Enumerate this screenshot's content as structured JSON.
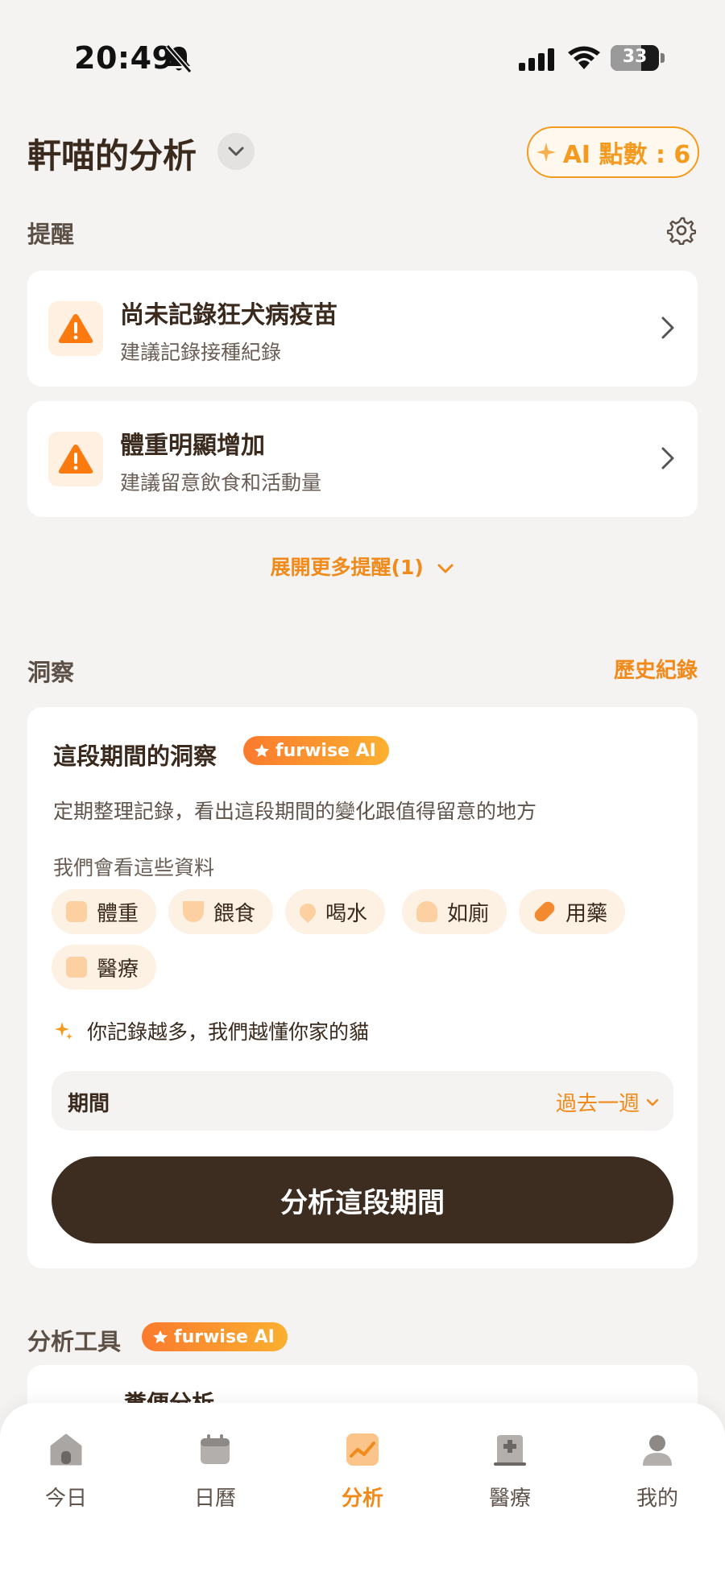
{
  "status_bar": {
    "time": "20:49",
    "battery": "33"
  },
  "header": {
    "title": "軒喵的分析",
    "ai_points_label": "AI 點數 : 6"
  },
  "reminders": {
    "heading": "提醒",
    "items": [
      {
        "title": "尚未記錄狂犬病疫苗",
        "subtitle": "建議記錄接種紀錄"
      },
      {
        "title": "體重明顯增加",
        "subtitle": "建議留意飲食和活動量"
      }
    ],
    "expand_label": "展開更多提醒(1)"
  },
  "insights": {
    "heading": "洞察",
    "history_link": "歷史紀錄",
    "card_title": "這段期間的洞察",
    "badge": "furwise AI",
    "description": "定期整理記錄，看出這段期間的變化跟值得留意的地方",
    "data_label": "我們會看這些資料",
    "chips": [
      "體重",
      "餵食",
      "喝水",
      "如廁",
      "用藥",
      "醫療"
    ],
    "hint": "你記錄越多，我們越懂你家的貓",
    "period_label": "期間",
    "period_value": "過去一週",
    "analyze_button": "分析這段期間"
  },
  "tools": {
    "heading": "分析工具",
    "badge": "furwise AI",
    "first_tool": "糞便分析"
  },
  "bottom_nav": {
    "items": [
      {
        "label": "今日",
        "icon": "home-icon"
      },
      {
        "label": "日曆",
        "icon": "calendar-icon"
      },
      {
        "label": "分析",
        "icon": "chart-icon",
        "active": true
      },
      {
        "label": "醫療",
        "icon": "hospital-icon"
      },
      {
        "label": "我的",
        "icon": "profile-icon"
      }
    ]
  },
  "colors": {
    "accent": "#f08a1a",
    "dark_button": "#3d2d21",
    "background": "#f4f3f2"
  }
}
